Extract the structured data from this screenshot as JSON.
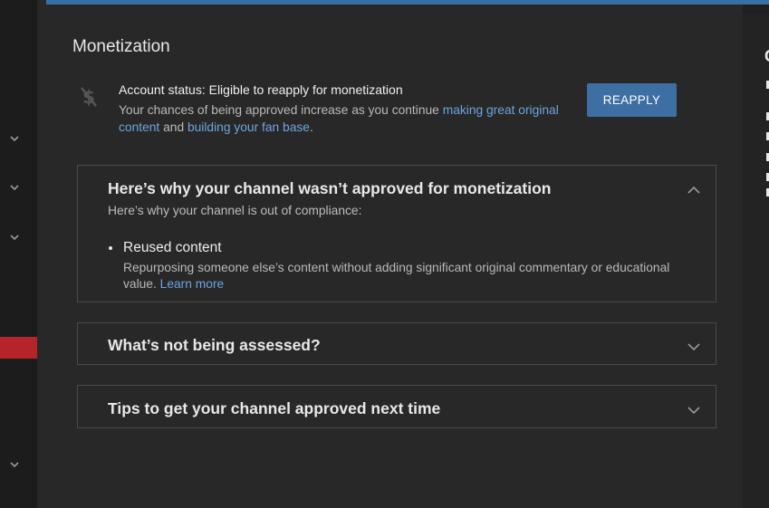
{
  "left_nav": {
    "active_color": "#b7232b",
    "chevron_icon": "chevron-down-icon"
  },
  "header": {
    "accent_color": "#3a6fa5"
  },
  "right_panel": {
    "partial_letter": "C"
  },
  "monetization": {
    "title": "Monetization",
    "status_icon": "no-money-icon",
    "status_text": "Account status: Eligible to reapply for monetization",
    "desc_before": "Your chances of being approved increase as you continue ",
    "desc_link1": "making great original content",
    "desc_middle": " and ",
    "desc_link2": "building your fan base",
    "desc_after": ".",
    "reapply_label": "REAPPLY"
  },
  "panels": [
    {
      "title": "Here’s why your channel wasn’t approved for monetization",
      "expanded": true,
      "subtitle": "Here’s why your channel is out of compliance:",
      "items": [
        {
          "title": "Reused content",
          "description": "Repurposing someone else’s content without adding significant original commentary or educational value. ",
          "link": "Learn more"
        }
      ]
    },
    {
      "title": "What’s not being assessed?",
      "expanded": false
    },
    {
      "title": "Tips to get your channel approved next time",
      "expanded": false
    }
  ]
}
